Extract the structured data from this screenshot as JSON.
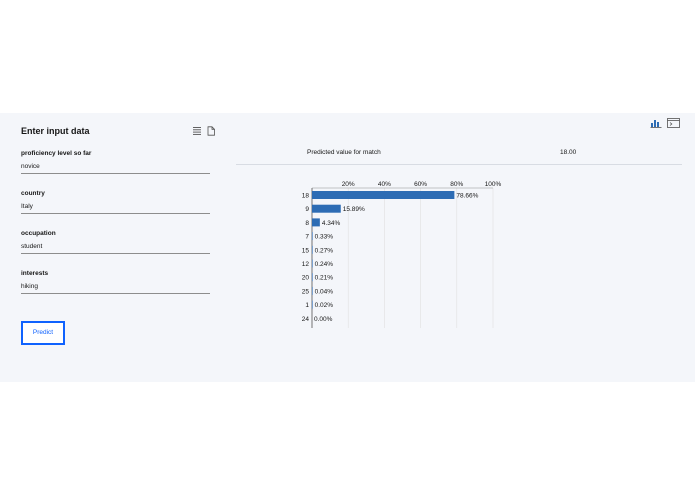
{
  "left": {
    "title": "Enter input data",
    "icons": {
      "list": "list-view-icon",
      "file": "document-icon"
    }
  },
  "form": {
    "fields": [
      {
        "label": "proficiency level so far",
        "value": "novice"
      },
      {
        "label": "country",
        "value": "Italy"
      },
      {
        "label": "occupation",
        "value": "student"
      },
      {
        "label": "interests",
        "value": "hiking"
      }
    ]
  },
  "predict_button": {
    "label": "Predict"
  },
  "top_right_icons": [
    "bar-chart-icon",
    "terminal-icon"
  ],
  "prediction": {
    "label": "Predicted value for match",
    "value": "18.00"
  },
  "chart_data": {
    "type": "bar",
    "orientation": "horizontal",
    "categories": [
      "18",
      "9",
      "8",
      "7",
      "15",
      "12",
      "20",
      "25",
      "1",
      "24"
    ],
    "values": [
      78.66,
      15.89,
      4.34,
      0.33,
      0.27,
      0.24,
      0.21,
      0.04,
      0.02,
      0.0
    ],
    "value_labels": [
      "78.66%",
      "15.89%",
      "4.34%",
      "0.33%",
      "0.27%",
      "0.24%",
      "0.21%",
      "0.04%",
      "0.02%",
      "0.00%"
    ],
    "x_ticks": [
      "20%",
      "40%",
      "60%",
      "80%",
      "100%"
    ],
    "xlim": [
      0,
      100
    ],
    "grid": true,
    "bar_color": "#2d6cb4"
  },
  "colors": {
    "panel_bg": "#f4f6fa",
    "accent": "#0f62fe"
  }
}
